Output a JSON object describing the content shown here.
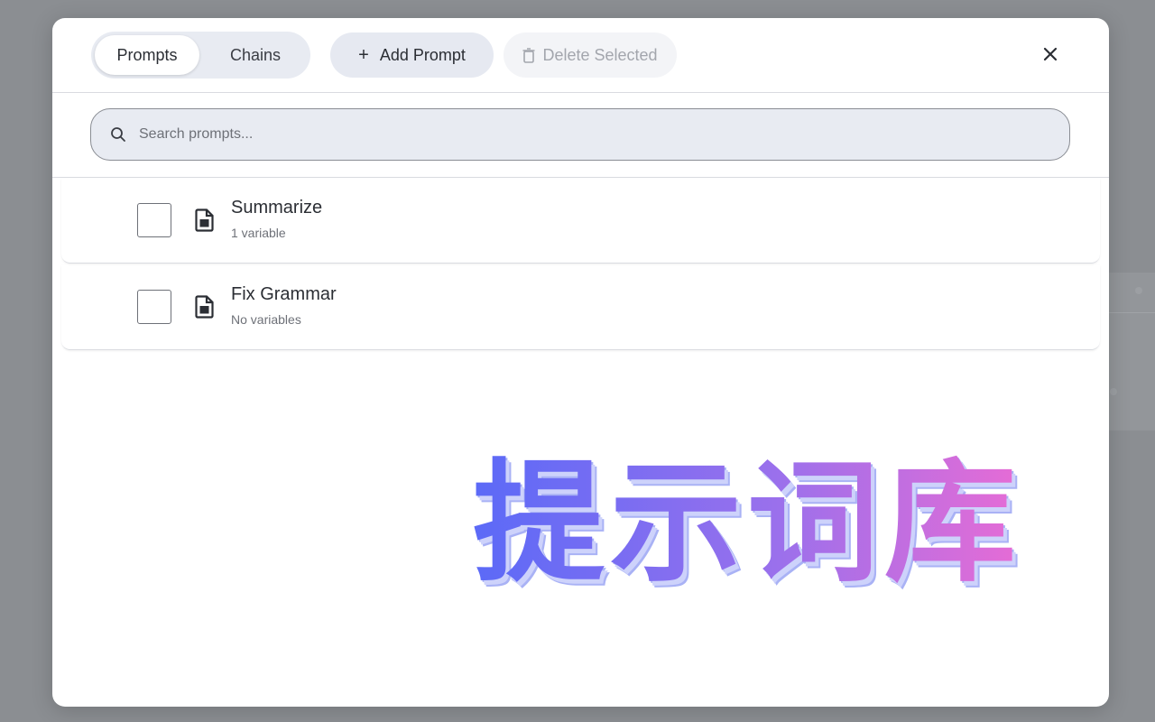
{
  "tabs": [
    {
      "label": "Prompts",
      "active": true
    },
    {
      "label": "Chains",
      "active": false
    }
  ],
  "toolbar": {
    "add_icon": "+",
    "add_label": "Add Prompt",
    "delete_label": "Delete Selected",
    "delete_icon": "trash-icon",
    "close_icon": "close-icon"
  },
  "search": {
    "placeholder": "Search prompts...",
    "icon": "search-icon"
  },
  "prompts": [
    {
      "title": "Summarize",
      "subtitle": "1 variable",
      "checked": false,
      "icon": "document-icon"
    },
    {
      "title": "Fix Grammar",
      "subtitle": "No variables",
      "checked": false,
      "icon": "document-icon"
    }
  ],
  "overlay": {
    "title": "提示词库",
    "colors": [
      "#5b6af7",
      "#9a70ec",
      "#f86bd0"
    ]
  },
  "theme": {
    "backdrop": "#8b8e92",
    "surface": "#ffffff",
    "chip": "#e8ebf2",
    "text": "#2b2e34",
    "muted": "#6e7178"
  }
}
